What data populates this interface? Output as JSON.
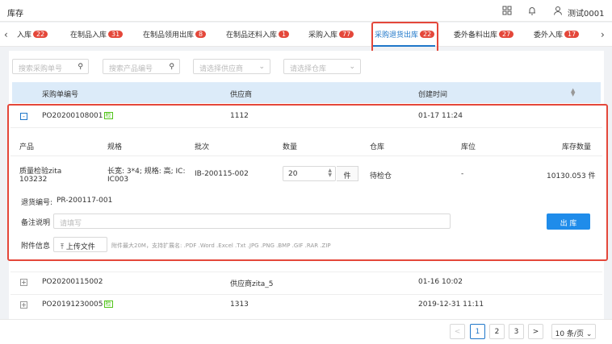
{
  "header": {
    "title": "库存",
    "user": "测试0001",
    "icons": [
      "grid-icon",
      "bell-icon",
      "user-icon"
    ]
  },
  "tabs": [
    {
      "label": "入库",
      "badge": "22"
    },
    {
      "label": "在制品入库",
      "badge": "31"
    },
    {
      "label": "在制品领用出库",
      "badge": "8"
    },
    {
      "label": "在制品还料入库",
      "badge": "1"
    },
    {
      "label": "采购入库",
      "badge": "77"
    },
    {
      "label": "采购退货出库",
      "badge": "22",
      "active": true
    },
    {
      "label": "委外备料出库",
      "badge": "27"
    },
    {
      "label": "委外入库",
      "badge": "17"
    }
  ],
  "filters": {
    "order_placeholder": "搜索采购单号",
    "product_placeholder": "搜索产品编号",
    "supplier_placeholder": "请选择供应商",
    "warehouse_placeholder": "请选择仓库"
  },
  "table": {
    "columns": {
      "order": "采购单编号",
      "supplier": "供应商",
      "created": "创建时间"
    },
    "rows": [
      {
        "order": "PO20200108001",
        "tag": "检",
        "supplier": "1112",
        "created": "01-17 11:24",
        "expanded": true
      },
      {
        "order": "PO20200115002",
        "tag": "",
        "supplier": "供应商zita_5",
        "created": "01-16 10:02"
      },
      {
        "order": "PO20191230005",
        "tag": "检",
        "supplier": "1313",
        "created": "2019-12-31 11:11"
      }
    ]
  },
  "detail": {
    "columns": {
      "product": "产品",
      "spec": "规格",
      "batch": "批次",
      "qty": "数量",
      "warehouse": "仓库",
      "location": "库位",
      "stock": "库存数量"
    },
    "item": {
      "product_name": "质量检验zita",
      "product_code": "103232",
      "spec_line1": "长宽: 3*4; 规格: 高; IC:",
      "spec_line2": "IC003",
      "batch": "IB-200115-002",
      "qty": "20",
      "unit": "件",
      "warehouse": "待检仓",
      "location": "-",
      "stock": "10130.053 件"
    },
    "return_label": "退货编号:",
    "return_no": "PR-200117-001",
    "remark_label": "备注说明",
    "remark_placeholder": "请填写",
    "out_button": "出 库",
    "attach_label": "附件信息",
    "upload_button": "上传文件",
    "upload_hint": "附件最大20M，支持扩展名: .PDF .Word .Excel .Txt .JPG .PNG .BMP .GIF .RAR .ZIP"
  },
  "pagination": {
    "prev": "<",
    "pages": [
      "1",
      "2",
      "3"
    ],
    "current": "1",
    "next": ">",
    "page_size": "10 条/页"
  },
  "colors": {
    "accent": "#1f77c9",
    "badge": "#e4473a",
    "header_bg": "#dcebf9",
    "highlight": "#e4473a"
  }
}
